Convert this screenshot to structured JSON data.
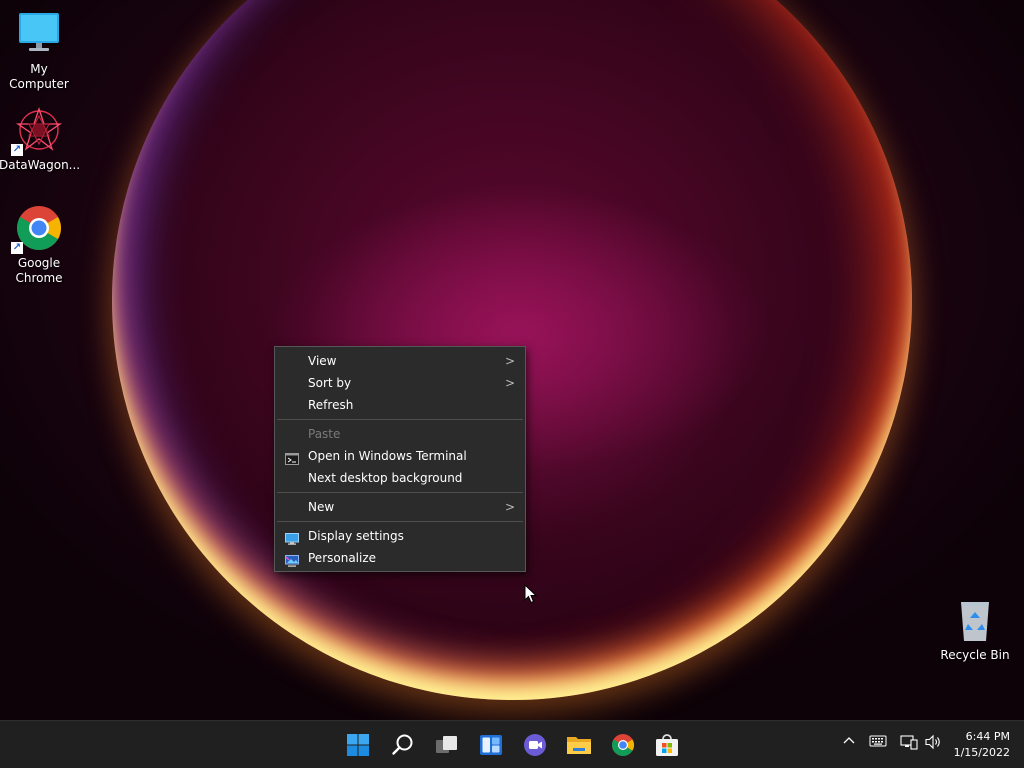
{
  "desktop": {
    "icons": [
      {
        "label": "My Computer"
      },
      {
        "label": "DataWagon..."
      },
      {
        "label": "Google Chrome"
      },
      {
        "label": "Recycle Bin"
      }
    ]
  },
  "context_menu": {
    "items": [
      {
        "label": "View",
        "submenu": true
      },
      {
        "label": "Sort by",
        "submenu": true
      },
      {
        "label": "Refresh"
      },
      {
        "label": "Paste",
        "disabled": true
      },
      {
        "label": "Open in Windows Terminal",
        "icon": "terminal-icon"
      },
      {
        "label": "Next desktop background"
      },
      {
        "label": "New",
        "submenu": true
      },
      {
        "label": "Display settings",
        "icon": "display-icon"
      },
      {
        "label": "Personalize",
        "icon": "personalize-icon"
      }
    ],
    "submenu_arrow": ">"
  },
  "taskbar": {
    "apps": [
      "start-icon",
      "search-icon",
      "task-view-icon",
      "widgets-icon",
      "chat-icon",
      "file-explorer-icon",
      "chrome-icon",
      "store-icon"
    ],
    "tray": {
      "chevron": "^",
      "icons": [
        "keyboard-icon",
        "network-icon",
        "volume-icon"
      ]
    },
    "clock": {
      "time": "6:44 PM",
      "date": "1/15/2022"
    }
  },
  "colors": {
    "menu_bg": "#2b2b2b",
    "taskbar_bg": "#202020",
    "accent": "#0078d4"
  }
}
